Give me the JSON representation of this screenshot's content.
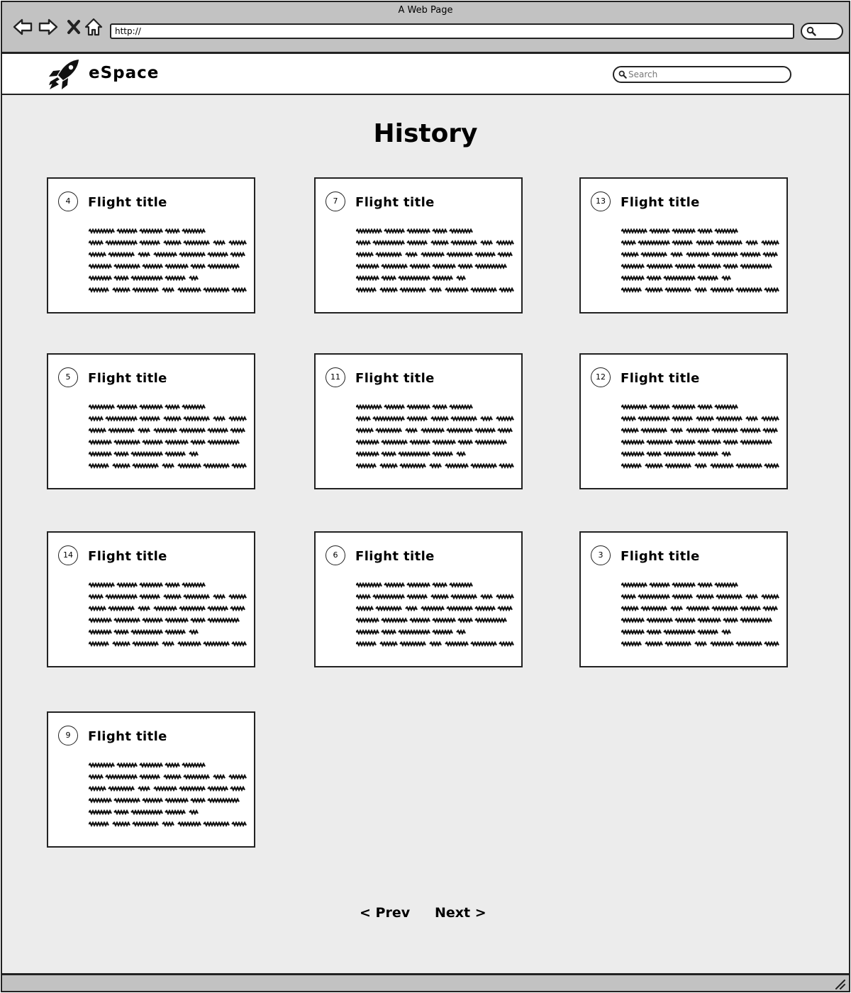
{
  "browser": {
    "window_title": "A Web Page",
    "url": "http://",
    "nav_icons": [
      "back-arrow-icon",
      "forward-arrow-icon",
      "stop-icon",
      "home-icon"
    ]
  },
  "header": {
    "brand": "eSpace",
    "logo_icon": "rocket-icon",
    "search_placeholder": "Search"
  },
  "page": {
    "title": "History"
  },
  "cards": [
    {
      "number": "4",
      "title": "Flight title"
    },
    {
      "number": "7",
      "title": "Flight title"
    },
    {
      "number": "13",
      "title": "Flight title"
    },
    {
      "number": "5",
      "title": "Flight title"
    },
    {
      "number": "11",
      "title": "Flight title"
    },
    {
      "number": "12",
      "title": "Flight title"
    },
    {
      "number": "14",
      "title": "Flight title"
    },
    {
      "number": "6",
      "title": "Flight title"
    },
    {
      "number": "3",
      "title": "Flight title"
    },
    {
      "number": "9",
      "title": "Flight title"
    }
  ],
  "pagination": {
    "prev": "< Prev",
    "next": "Next >"
  },
  "colors": {
    "page_bg": "#ececec",
    "chrome_bg": "#c2c2c2",
    "border": "#222222"
  }
}
